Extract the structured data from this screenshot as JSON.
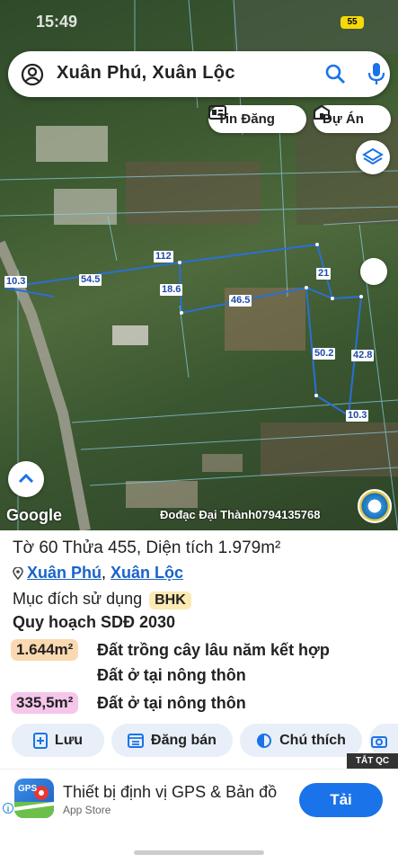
{
  "status": {
    "time": "15:49",
    "battery": "55"
  },
  "search": {
    "query": "Xuân Phú, Xuân Lộc"
  },
  "chips": {
    "tin_dang": "Tin Đăng",
    "du_an": "Dự Án"
  },
  "map": {
    "labels": [
      "10.3",
      "54.5",
      "112",
      "18.6",
      "46.5",
      "21",
      "50.2",
      "42.8",
      "10.3"
    ],
    "google": "Google",
    "credit": "Đođạc Đại Thành0794135768"
  },
  "parcel": {
    "title": "Tờ 60 Thửa 455, Diện tích 1.979m²",
    "commune": "Xuân Phú",
    "separator": ",",
    "district": "Xuân Lộc",
    "purpose_label": "Mục đích sử dụng",
    "purpose_code": "BHK",
    "plan_title": "Quy hoạch SDĐ 2030",
    "zones": [
      {
        "area": "1.644m²",
        "desc1": "Đất trồng cây lâu năm kết hợp",
        "desc2": "Đất ở tại nông thôn",
        "color": "#fbd9b0"
      },
      {
        "area": "335,5m²",
        "desc1": "Đất ở tại nông thôn",
        "color": "#f6c6ea"
      }
    ]
  },
  "actions": {
    "save": "Lưu",
    "post": "Đăng bán",
    "legend": "Chú thích"
  },
  "ad": {
    "close": "TẮT QC",
    "title": "Thiết bị định vị GPS & Bản đồ",
    "store": "App Store",
    "install": "Tải",
    "icon_text": "GPS",
    "info": "i"
  },
  "colors": {
    "accent": "#1a73e8",
    "link": "#1a63c9",
    "parcel_line": "#2a6fd6",
    "button_bg": "#e8eff8"
  }
}
